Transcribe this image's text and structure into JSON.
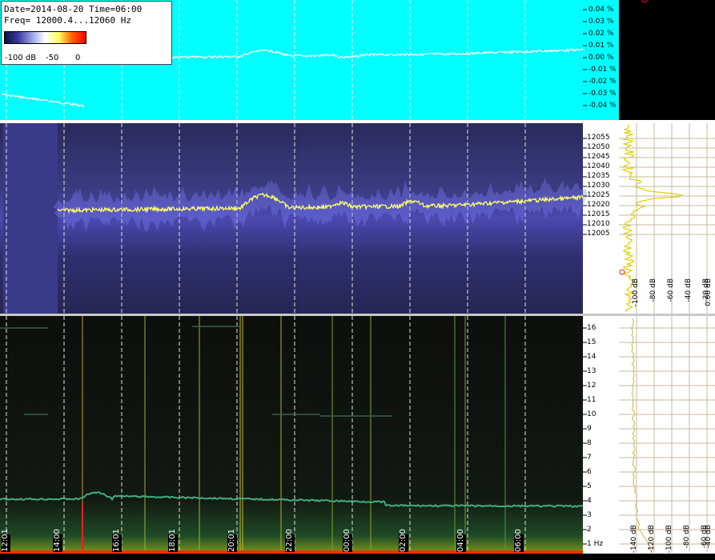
{
  "header": {
    "date_line": "Date=2014-08-20 Time=06:00",
    "freq_line": "Freq= 12000.4...12060 Hz"
  },
  "colorbar": {
    "labels": [
      "-100 dB",
      "-50",
      "0"
    ]
  },
  "top_panel": {
    "y_ticks": [
      "0.04 %",
      "0.03 %",
      "0.02 %",
      "0.01 %",
      "0.00 %",
      "-0.01 %",
      "-0.02 %",
      "-0.03 %",
      "-0.04 %"
    ],
    "bg_color": "#00ffff"
  },
  "mid_panel": {
    "y_ticks": [
      "12055",
      "12050",
      "12045",
      "12040",
      "12035",
      "12030",
      "12025",
      "12020",
      "12015",
      "12010",
      "12005"
    ],
    "db_labels": [
      "-100 dB",
      "-80 dB",
      "-60 dB",
      "-40 dB",
      "-20 dB",
      "0.00 dB"
    ]
  },
  "bottom_panel": {
    "y_ticks": [
      "16",
      "15",
      "14",
      "13",
      "12",
      "11",
      "10",
      "9",
      "8",
      "7",
      "6",
      "5",
      "4",
      "3",
      "2",
      "1 Hz"
    ],
    "db_labels": [
      "-140 dB",
      "-120 dB",
      "-100 dB",
      "-80 dB",
      "-60 dB",
      "-40 dB"
    ],
    "time_labels": [
      "12:01",
      "14:00",
      "16:01",
      "18:01",
      "20:01",
      "22:00",
      "00:00",
      "02:00",
      "04:00",
      "06:00"
    ]
  },
  "colors": {
    "trace_top": "#ffffff",
    "trace_mid": "#ffff66",
    "trace_bottom": "#40b080",
    "separator": "#ffffff"
  }
}
